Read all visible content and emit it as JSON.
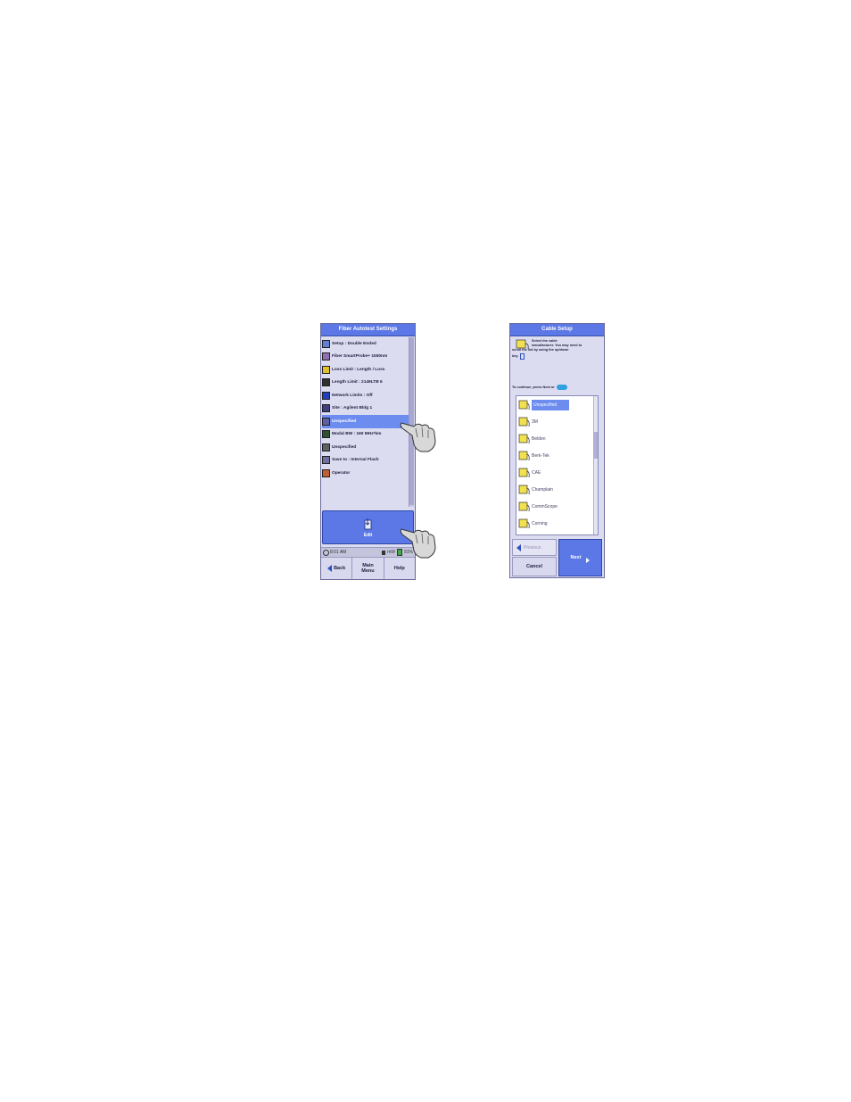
{
  "left_screen": {
    "title": "Fiber Autotest Settings",
    "settings": [
      {
        "label": "Setup : Double Ended",
        "icon": "setup-icon"
      },
      {
        "label": "Fiber SmartProbe+ 1550nm",
        "icon": "probe-icon"
      },
      {
        "label": "Loss Limit : Length / Loss",
        "icon": "loss-limit-icon"
      },
      {
        "label": "Length Limit : 2149LTB 6",
        "icon": "length-limit-icon"
      },
      {
        "label": "Network Limits : Off",
        "icon": "network-limits-icon"
      },
      {
        "label": "Site : Agilent Bldg 1",
        "icon": "site-icon"
      },
      {
        "label": "Unspecified",
        "icon": "cable-icon"
      },
      {
        "label": "Modal BW : 160 MHz*km",
        "icon": "modal-bw-icon"
      },
      {
        "label": "Unspecified",
        "icon": "connector-icon"
      },
      {
        "label": "Save to : Internal Flash",
        "icon": "save-icon"
      },
      {
        "label": "Operator",
        "icon": "operator-icon"
      }
    ],
    "selected_index": 6,
    "edit_label": "Edit",
    "status": {
      "time": "8:01 AM",
      "signal": "mW",
      "battery": "91%"
    },
    "nav": {
      "back": "Back",
      "main_menu_line1": "Main",
      "main_menu_line2": "Menu",
      "help": "Help"
    }
  },
  "right_screen": {
    "title": "Cable Setup",
    "instruction_line1": "Select the cable",
    "instruction_line2": "manufacturer. You may need to",
    "instruction_line3": "scroll the list by using the up/down",
    "instruction_line4": "key.",
    "continue_text": "To continue, press Next or",
    "manufacturers": [
      "Unspecified",
      "3M",
      "Belden",
      "Berk-Tek",
      "CAE",
      "Champlain",
      "CommScope",
      "Corning"
    ],
    "selected_index": 0,
    "previous_label": "Previous",
    "cancel_label": "Cancel",
    "next_label": "Next"
  },
  "colors": {
    "accent": "#5b78e6",
    "selection": "#6c8cf0",
    "panel": "#dcdcf0"
  }
}
